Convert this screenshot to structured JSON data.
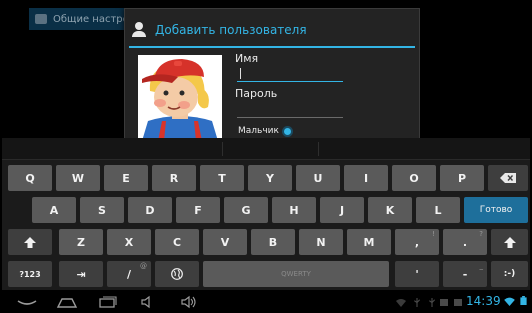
{
  "background": {
    "settings_header_label": "Общие настройки"
  },
  "dialog": {
    "title": "Добавить пользователя",
    "name_label": "Имя",
    "password_label": "Пароль",
    "gender_label": "Мальчик"
  },
  "keyboard": {
    "row1": [
      "Q",
      "W",
      "E",
      "R",
      "T",
      "Y",
      "U",
      "I",
      "O",
      "P"
    ],
    "row2": [
      "A",
      "S",
      "D",
      "F",
      "G",
      "H",
      "J",
      "K",
      "L"
    ],
    "done_label": "Готово",
    "row3": [
      "Z",
      "X",
      "C",
      "V",
      "B",
      "N",
      "M"
    ],
    "row3_punct": [
      ",",
      "."
    ],
    "row3_hints": [
      "!",
      "?"
    ],
    "symbols_label": "?123",
    "tab_label": "⇥",
    "slash_label": "/",
    "slash_hint": "@",
    "space_label": "QWERTY",
    "apostrophe_label": "'",
    "dash_label": "-",
    "dash_hint": "_",
    "smiley_label": ":-)"
  },
  "status_bar": {
    "time": "14:39"
  },
  "colors": {
    "accent": "#33b5e5",
    "key": "#5a5a5a",
    "key_dark": "#3e3e3e",
    "done_key": "#1e6f9b"
  },
  "icons": [
    "settings-icon",
    "user-icon",
    "backspace-icon",
    "shift-icon",
    "globe-icon",
    "back-icon",
    "home-icon",
    "recent-apps-icon",
    "volume-down-icon",
    "volume-up-icon",
    "usb-icon",
    "wifi-icon",
    "battery-icon"
  ]
}
